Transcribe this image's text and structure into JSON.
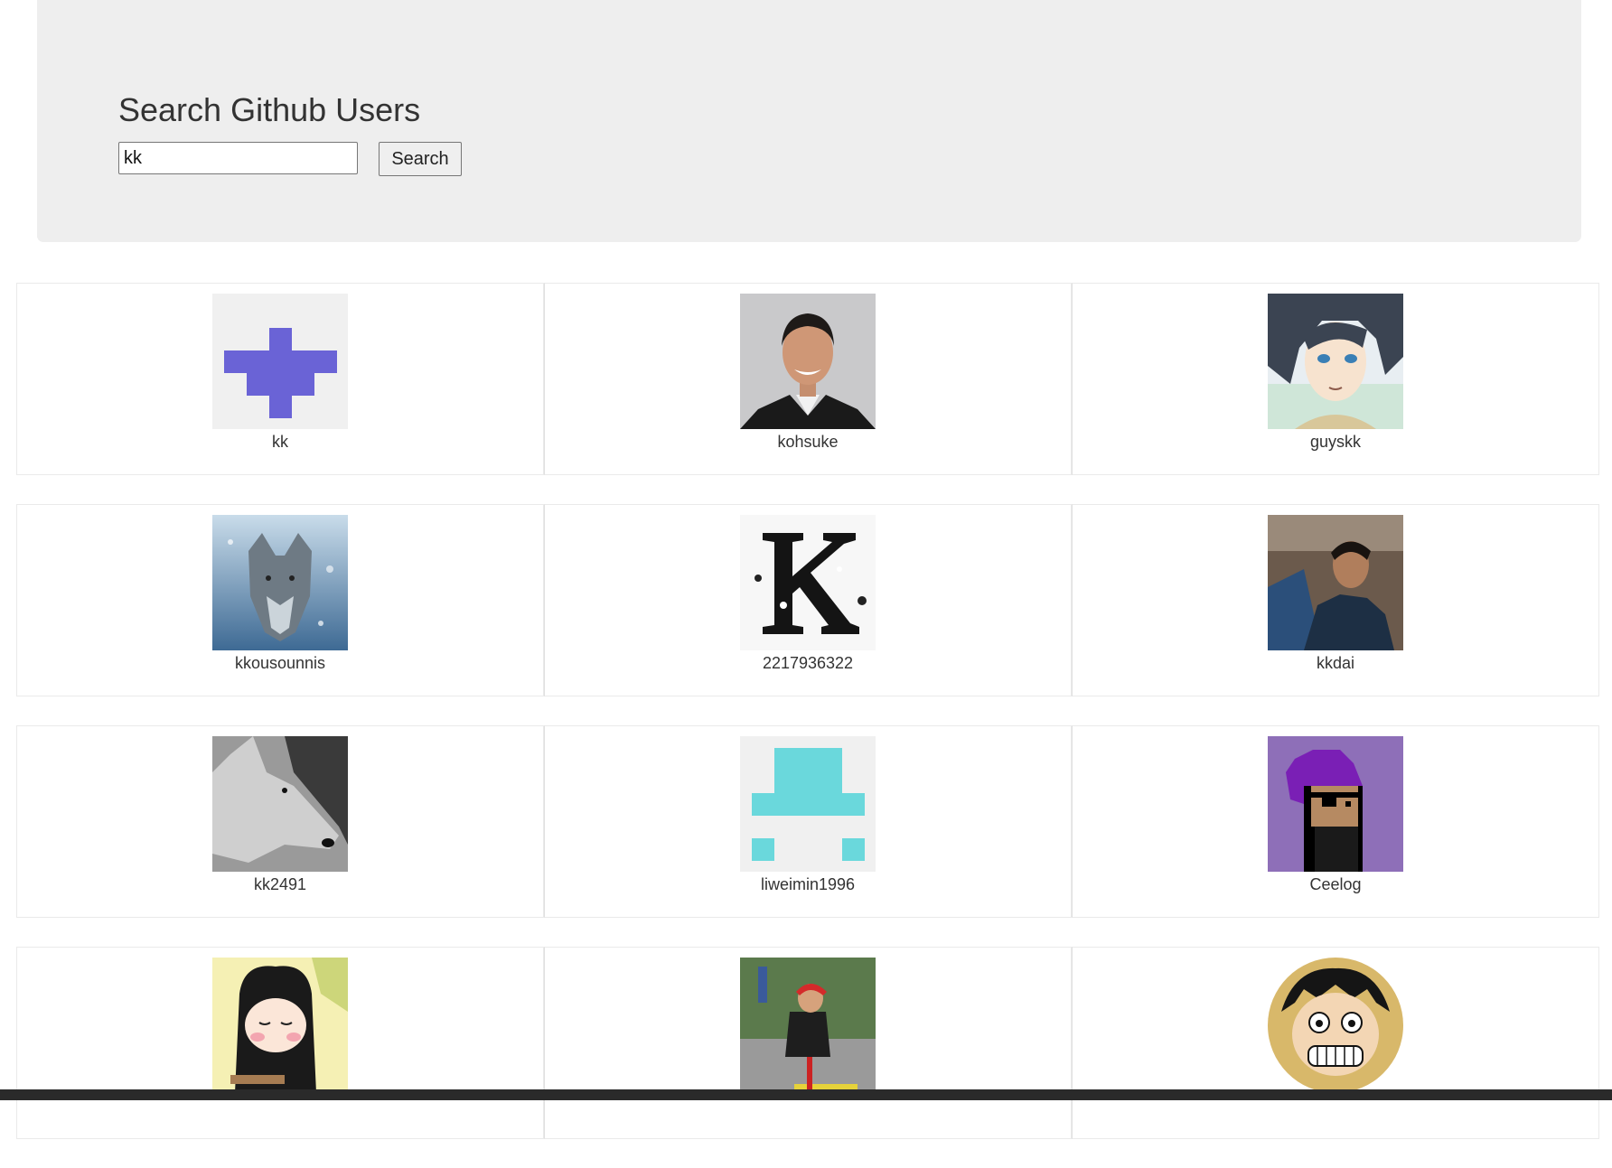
{
  "header": {
    "title": "Search Github Users",
    "search_value": "kk",
    "search_button": "Search"
  },
  "users": [
    {
      "login": "kk",
      "avatar": "identicon-purple-cross-icon"
    },
    {
      "login": "kohsuke",
      "avatar": "portrait-man-suit-icon"
    },
    {
      "login": "guyskk",
      "avatar": "anime-character-icon"
    },
    {
      "login": "kkousounnis",
      "avatar": "wolf-snow-icon"
    },
    {
      "login": "2217936322",
      "avatar": "letter-k-grunge-icon"
    },
    {
      "login": "kkdai",
      "avatar": "person-conference-icon"
    },
    {
      "login": "kk2491",
      "avatar": "wolf-grayscale-icon"
    },
    {
      "login": "liweimin1996",
      "avatar": "identicon-teal-icon"
    },
    {
      "login": "Ceelog",
      "avatar": "pixel-pirate-icon"
    },
    {
      "login": "",
      "avatar": "cartoon-girl-icon"
    },
    {
      "login": "",
      "avatar": "cyclist-icon"
    },
    {
      "login": "",
      "avatar": "anime-luffy-icon"
    }
  ]
}
